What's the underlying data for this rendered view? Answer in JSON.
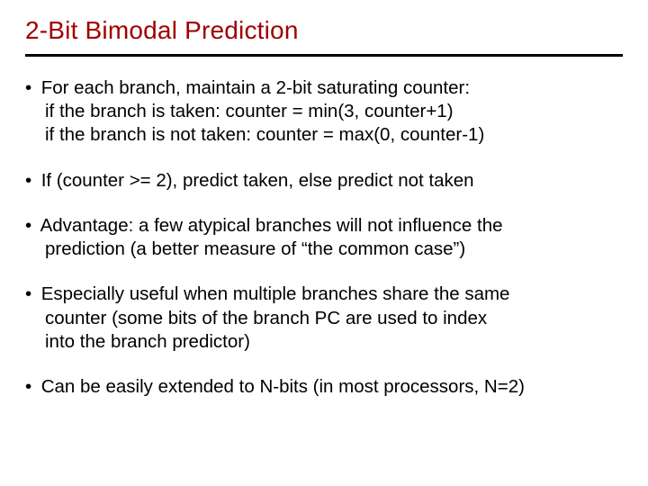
{
  "title": "2-Bit Bimodal Prediction",
  "bullets": [
    {
      "lead": "For each branch, maintain a 2-bit saturating counter:",
      "cont": [
        "if the branch is taken: counter = min(3, counter+1)",
        "if the branch is not taken: counter = max(0, counter-1)"
      ]
    },
    {
      "lead": "If (counter >= 2), predict taken, else predict not taken",
      "cont": []
    },
    {
      "lead": "Advantage: a few atypical branches will not influence the",
      "cont": [
        "prediction (a better measure of “the common case”)"
      ]
    },
    {
      "lead": "Especially useful when multiple branches share the same",
      "cont": [
        "counter (some bits of the branch PC are used to index",
        "into the branch predictor)"
      ]
    },
    {
      "lead": "Can be easily extended to N-bits (in most processors, N=2)",
      "cont": []
    }
  ]
}
